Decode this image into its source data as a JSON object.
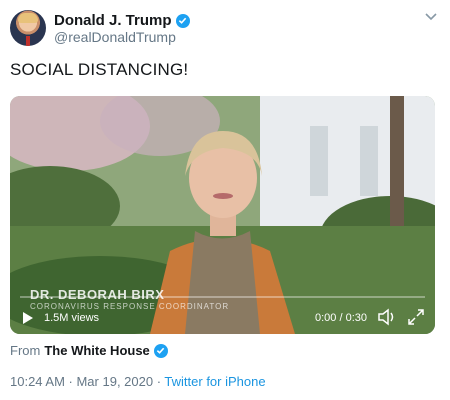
{
  "author": {
    "display_name": "Donald J. Trump",
    "handle": "@realDonaldTrump",
    "verified_icon": "verified-badge-icon"
  },
  "tweet": {
    "text": "SOCIAL DISTANCING!"
  },
  "video": {
    "caption_name": "DR. DEBORAH BIRX",
    "caption_role": "CORONAVIRUS RESPONSE COORDINATOR",
    "views": "1.5M views",
    "time": "0:00 / 0:30",
    "progress": 0
  },
  "source": {
    "from_label": "From",
    "org_name": "The White House"
  },
  "meta": {
    "timestamp": "10:24 AM · Mar 19, 2020",
    "separator": " · ",
    "client": "Twitter for iPhone"
  },
  "colors": {
    "accent": "#1da1f2",
    "link": "#1b95e0",
    "secondary_text": "#657786"
  }
}
